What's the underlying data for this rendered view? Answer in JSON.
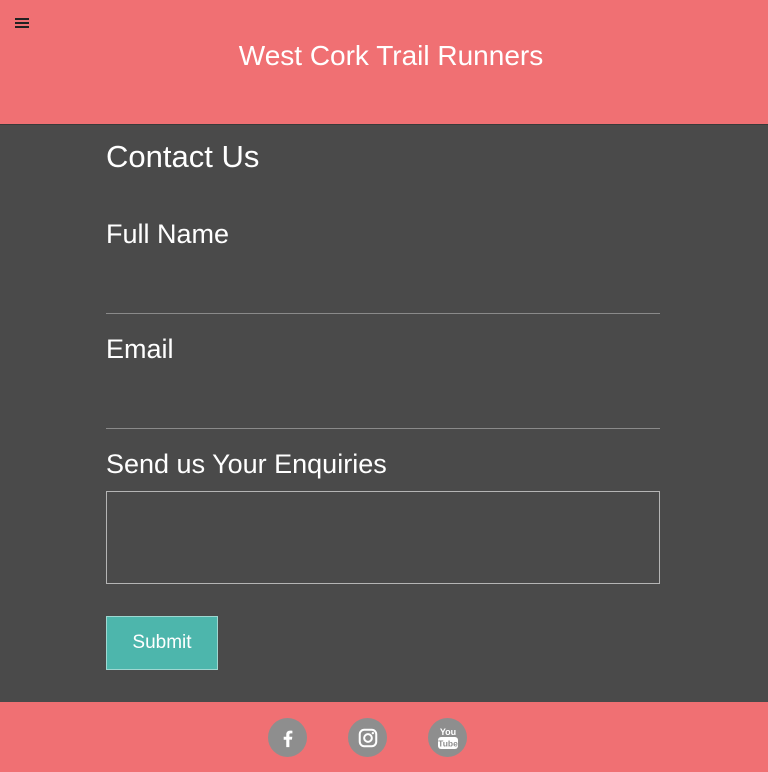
{
  "header": {
    "title": "West Cork Trail Runners",
    "menu_icon": "hamburger-menu-icon"
  },
  "form": {
    "heading": "Contact Us",
    "full_name_label": "Full Name",
    "full_name_value": "",
    "email_label": "Email",
    "email_value": "",
    "enquiries_label": "Send us Your Enquiries",
    "enquiries_value": "",
    "submit_label": "Submit"
  },
  "footer": {
    "social": [
      {
        "name": "facebook",
        "icon": "facebook-icon"
      },
      {
        "name": "instagram",
        "icon": "instagram-icon"
      },
      {
        "name": "youtube",
        "icon": "youtube-icon",
        "icon_text_top": "You",
        "icon_text_bottom": "Tube"
      }
    ]
  },
  "colors": {
    "header_bg": "#f07073",
    "page_bg": "#4a4a4a",
    "button_bg": "#4db6ac",
    "social_bg": "#8e8e8e"
  }
}
